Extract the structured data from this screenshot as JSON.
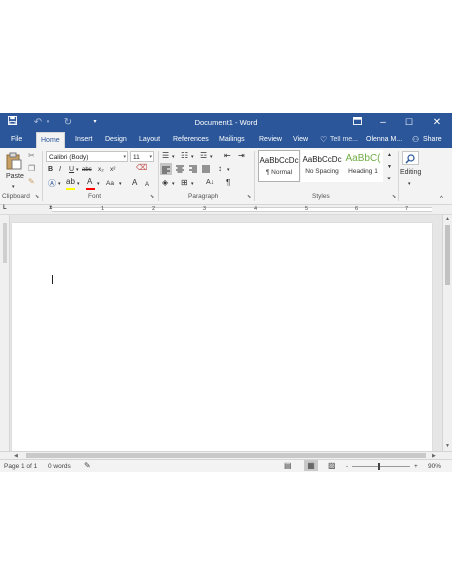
{
  "window": {
    "title": "Document1 - Word"
  },
  "titlebar": {
    "save_icon": "save-icon",
    "undo_icon": "undo-icon",
    "redo_icon": "redo-icon",
    "customize_icon": "customize-quick-access-icon",
    "ribbon_display_icon": "ribbon-display-options-icon",
    "minimize_glyph": "–",
    "maximize_glyph": "☐",
    "close_glyph": "✕"
  },
  "tabs": [
    {
      "label": "File"
    },
    {
      "label": "Home"
    },
    {
      "label": "Insert"
    },
    {
      "label": "Design"
    },
    {
      "label": "Layout"
    },
    {
      "label": "References"
    },
    {
      "label": "Mailings"
    },
    {
      "label": "Review"
    },
    {
      "label": "View"
    }
  ],
  "tell_me": {
    "label": "Tell me..."
  },
  "account": {
    "name": "Olenna M..."
  },
  "share": {
    "label": "Share"
  },
  "clipboard": {
    "label": "Clipboard",
    "paste_label": "Paste"
  },
  "font": {
    "label": "Font",
    "family": "Calibri (Body)",
    "size": "11",
    "bold": "B",
    "italic": "I",
    "underline": "U",
    "strikethrough": "abc",
    "subscript": "x₂",
    "superscript": "x²",
    "grow": "A",
    "shrink": "A",
    "change_case": "Aa"
  },
  "paragraph": {
    "label": "Paragraph",
    "pilcrow": "¶"
  },
  "styles": {
    "label": "Styles",
    "items": [
      {
        "sample": "AaBbCcDc",
        "name": "¶ Normal"
      },
      {
        "sample": "AaBbCcDc",
        "name": "No Spacing"
      },
      {
        "sample": "AaBbC(",
        "name": "Heading 1"
      }
    ]
  },
  "editing": {
    "label": "Editing"
  },
  "ruler": {
    "numbers": [
      "1",
      "2",
      "3",
      "4",
      "5",
      "6",
      "7"
    ],
    "tab_selector": "L"
  },
  "status": {
    "page": "Page 1 of 1",
    "words": "0 words",
    "zoom_minus": "-",
    "zoom_plus": "+",
    "zoom": "90%",
    "zoom_level_percent": 90
  },
  "colors": {
    "brand": "#2b579a",
    "ribbon_bg": "#f3f3f3",
    "highlight": "#ffff00",
    "font_color": "#ff0000",
    "heading_style": "#70ad47"
  }
}
